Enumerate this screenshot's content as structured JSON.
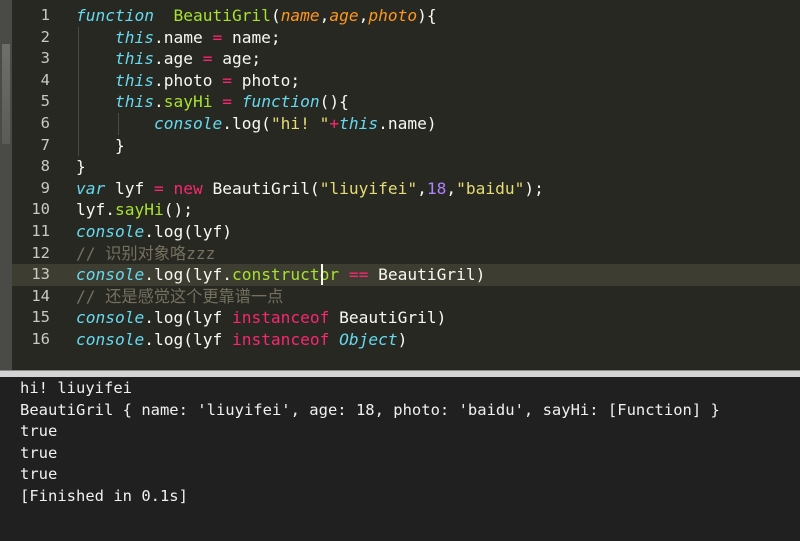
{
  "editor": {
    "lines": [
      {
        "n": "1",
        "t": [
          [
            "kw-i",
            "function"
          ],
          [
            "",
            "  "
          ],
          [
            "fn",
            "BeautiGril"
          ],
          [
            "",
            "("
          ],
          [
            "param",
            "name"
          ],
          [
            "",
            ","
          ],
          [
            "param",
            "age"
          ],
          [
            "",
            ","
          ],
          [
            "param",
            "photo"
          ],
          [
            "",
            "){"
          ]
        ]
      },
      {
        "n": "2",
        "t": [
          [
            "",
            "    "
          ],
          [
            "kw-i",
            "this"
          ],
          [
            "",
            ".name "
          ],
          [
            "op",
            "="
          ],
          [
            "",
            " name;"
          ]
        ]
      },
      {
        "n": "3",
        "t": [
          [
            "",
            "    "
          ],
          [
            "kw-i",
            "this"
          ],
          [
            "",
            ".age "
          ],
          [
            "op",
            "="
          ],
          [
            "",
            " age;"
          ]
        ]
      },
      {
        "n": "4",
        "t": [
          [
            "",
            "    "
          ],
          [
            "kw-i",
            "this"
          ],
          [
            "",
            ".photo "
          ],
          [
            "op",
            "="
          ],
          [
            "",
            " photo;"
          ]
        ]
      },
      {
        "n": "5",
        "t": [
          [
            "",
            "    "
          ],
          [
            "kw-i",
            "this"
          ],
          [
            "",
            "."
          ],
          [
            "fn",
            "sayHi"
          ],
          [
            "",
            " "
          ],
          [
            "op",
            "="
          ],
          [
            "",
            " "
          ],
          [
            "kw-i",
            "function"
          ],
          [
            "",
            "(){"
          ]
        ]
      },
      {
        "n": "6",
        "t": [
          [
            "",
            "        "
          ],
          [
            "kw-i",
            "console"
          ],
          [
            "",
            ".log("
          ],
          [
            "str",
            "\"hi! \""
          ],
          [
            "op",
            "+"
          ],
          [
            "kw-i",
            "this"
          ],
          [
            "",
            ".name)"
          ]
        ]
      },
      {
        "n": "7",
        "t": [
          [
            "",
            "    }"
          ]
        ]
      },
      {
        "n": "8",
        "t": [
          [
            "",
            "}"
          ]
        ]
      },
      {
        "n": "9",
        "t": [
          [
            "kw-i",
            "var"
          ],
          [
            "",
            " lyf "
          ],
          [
            "op",
            "="
          ],
          [
            "",
            " "
          ],
          [
            "op",
            "new"
          ],
          [
            "",
            " BeautiGril("
          ],
          [
            "str",
            "\"liuyifei\""
          ],
          [
            "",
            ","
          ],
          [
            "num",
            "18"
          ],
          [
            "",
            ","
          ],
          [
            "str",
            "\"baidu\""
          ],
          [
            "",
            ");"
          ]
        ]
      },
      {
        "n": "10",
        "t": [
          [
            "",
            "lyf."
          ],
          [
            "fn",
            "sayHi"
          ],
          [
            "",
            "();"
          ]
        ]
      },
      {
        "n": "11",
        "t": [
          [
            "kw-i",
            "console"
          ],
          [
            "",
            ".log(lyf)"
          ]
        ]
      },
      {
        "n": "12",
        "t": [
          [
            "cmt",
            "// 识别对象咯zzz"
          ]
        ]
      },
      {
        "n": "13",
        "t": [
          [
            "kw-i",
            "console"
          ],
          [
            "",
            ".log(lyf."
          ],
          [
            "fn",
            "constructor"
          ],
          [
            "",
            " "
          ],
          [
            "op",
            "=="
          ],
          [
            "",
            " BeautiGril)"
          ]
        ]
      },
      {
        "n": "14",
        "t": [
          [
            "cmt",
            "// 还是感觉这个更靠谱一点"
          ]
        ]
      },
      {
        "n": "15",
        "t": [
          [
            "kw-i",
            "console"
          ],
          [
            "",
            ".log(lyf "
          ],
          [
            "op",
            "instanceof"
          ],
          [
            "",
            " BeautiGril)"
          ]
        ]
      },
      {
        "n": "16",
        "t": [
          [
            "kw-i",
            "console"
          ],
          [
            "",
            ".log(lyf "
          ],
          [
            "op",
            "instanceof"
          ],
          [
            "",
            " "
          ],
          [
            "kw-i",
            "Object"
          ],
          [
            "",
            ")"
          ]
        ]
      }
    ],
    "active_line": "13"
  },
  "console": {
    "lines": [
      "hi! liuyifei",
      "BeautiGril { name: 'liuyifei', age: 18, photo: 'baidu', sayHi: [Function] }",
      "true",
      "true",
      "true",
      "[Finished in 0.1s]"
    ]
  },
  "colors": {
    "background": "#272822",
    "keyword": "#66d9ef",
    "function": "#a6e22e",
    "parameter": "#fd971f",
    "operator": "#f92672",
    "string": "#e6db74",
    "number": "#ae81ff",
    "comment": "#75715e",
    "console_bg": "#202020"
  }
}
